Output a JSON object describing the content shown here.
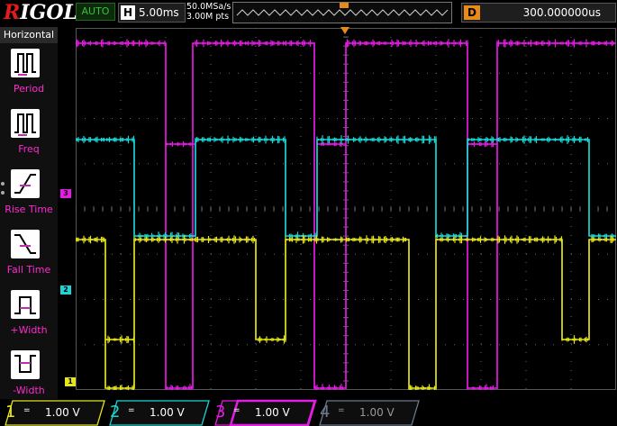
{
  "brand": {
    "logo": "RIGOL",
    "mode": "AUTO"
  },
  "timebase": {
    "prefix": "H",
    "value": "5.00ms"
  },
  "acquisition": {
    "sample_rate": "50.0MSa/s",
    "memory": "3.00M pts"
  },
  "trigger": {
    "marker": "T"
  },
  "delay": {
    "prefix": "D",
    "value": "300.000000us"
  },
  "menu": {
    "title": "Horizontal",
    "items": [
      {
        "label": "Period"
      },
      {
        "label": "Freq"
      },
      {
        "label": "Rise Time"
      },
      {
        "label": "Fall Time"
      },
      {
        "label": "+Width"
      },
      {
        "label": "-Width"
      }
    ]
  },
  "channels": [
    {
      "number": "1",
      "coupling": "=",
      "scale": "1.00 V",
      "color": "#e6e61b"
    },
    {
      "number": "2",
      "coupling": "=",
      "scale": "1.00 V",
      "color": "#1bd6d6"
    },
    {
      "number": "3",
      "coupling": "=",
      "scale": "1.00 V",
      "color": "#e61be6"
    },
    {
      "number": "4",
      "coupling": "=",
      "scale": "1.00 V",
      "color": "#6b7b8c"
    }
  ],
  "markers": [
    {
      "label": "3",
      "color": "#e61be6"
    },
    {
      "label": "2",
      "color": "#1bd6d6"
    },
    {
      "label": "1",
      "color": "#e6e61b"
    }
  ]
}
